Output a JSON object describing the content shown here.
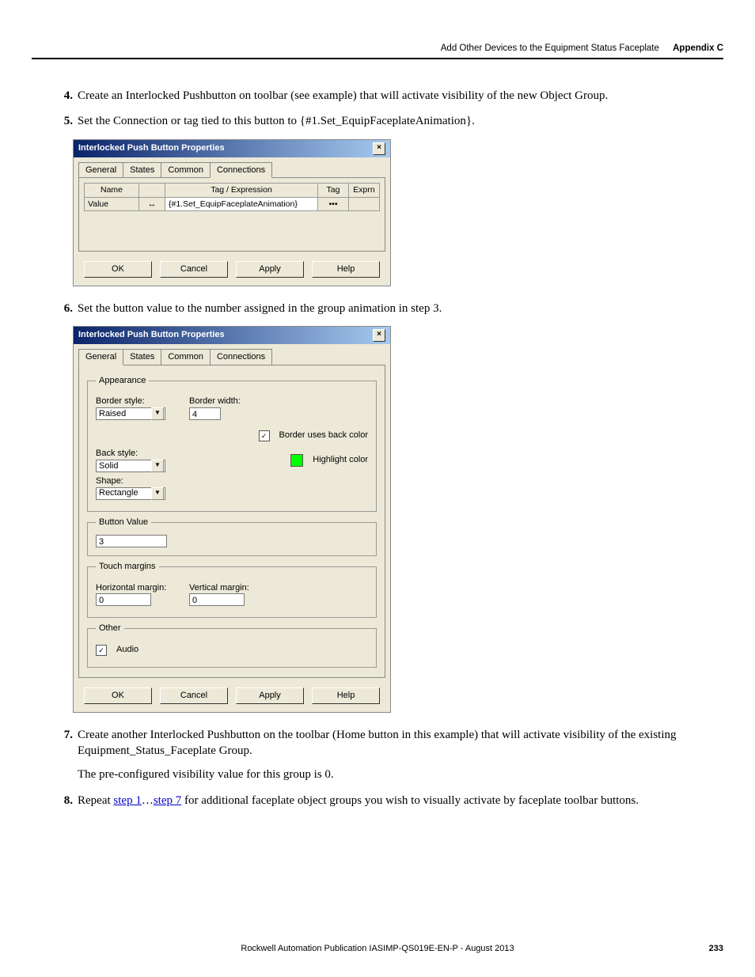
{
  "header": {
    "section": "Add Other Devices to the Equipment Status Faceplate",
    "appendix": "Appendix C"
  },
  "steps": {
    "s4": {
      "num": "4.",
      "text": "Create an Interlocked Pushbutton on toolbar (see example) that will activate visibility of the new Object Group."
    },
    "s5": {
      "num": "5.",
      "text": "Set the Connection or tag tied to this button to {#1.Set_EquipFaceplateAnimation}."
    },
    "s6": {
      "num": "6.",
      "text": "Set the button value to the number assigned in the group animation in step 3."
    },
    "s7": {
      "num": "7.",
      "text": "Create another Interlocked Pushbutton on the toolbar (Home button in this example) that will activate visibility of the existing Equipment_Status_Faceplate Group.",
      "sub": "The pre-configured visibility value for this group is 0."
    },
    "s8": {
      "num": "8.",
      "pre": "Repeat ",
      "link1": "step 1",
      "ellipsis": "…",
      "link2": "step 7",
      "post": " for additional faceplate object groups you wish to visually activate by faceplate toolbar buttons."
    }
  },
  "dialog1": {
    "title": "Interlocked Push Button Properties",
    "tabs": {
      "general": "General",
      "states": "States",
      "common": "Common",
      "connections": "Connections"
    },
    "table": {
      "h_name": "Name",
      "h_tagexpr": "Tag / Expression",
      "h_tag": "Tag",
      "h_exprn": "Exprn",
      "row_name": "Value",
      "arrow": "↔",
      "row_expr": "{#1.Set_EquipFaceplateAnimation}",
      "row_tag": "•••",
      "row_exprn": ""
    },
    "buttons": {
      "ok": "OK",
      "cancel": "Cancel",
      "apply": "Apply",
      "help": "Help"
    }
  },
  "dialog2": {
    "title": "Interlocked Push Button Properties",
    "tabs": {
      "general": "General",
      "states": "States",
      "common": "Common",
      "connections": "Connections"
    },
    "appearance": {
      "legend": "Appearance",
      "border_style_label": "Border style:",
      "border_style_value": "Raised",
      "border_width_label": "Border width:",
      "border_width_value": "4",
      "border_uses_back": "Border uses back color",
      "back_style_label": "Back style:",
      "back_style_value": "Solid",
      "highlight_label": "Highlight color",
      "shape_label": "Shape:",
      "shape_value": "Rectangle"
    },
    "button_value": {
      "legend": "Button Value",
      "value": "3"
    },
    "touch": {
      "legend": "Touch margins",
      "h_label": "Horizontal margin:",
      "h_value": "0",
      "v_label": "Vertical margin:",
      "v_value": "0"
    },
    "other": {
      "legend": "Other",
      "audio": "Audio"
    },
    "buttons": {
      "ok": "OK",
      "cancel": "Cancel",
      "apply": "Apply",
      "help": "Help"
    }
  },
  "footer": {
    "text": "Rockwell Automation Publication IASIMP-QS019E-EN-P - August 2013",
    "page": "233"
  }
}
